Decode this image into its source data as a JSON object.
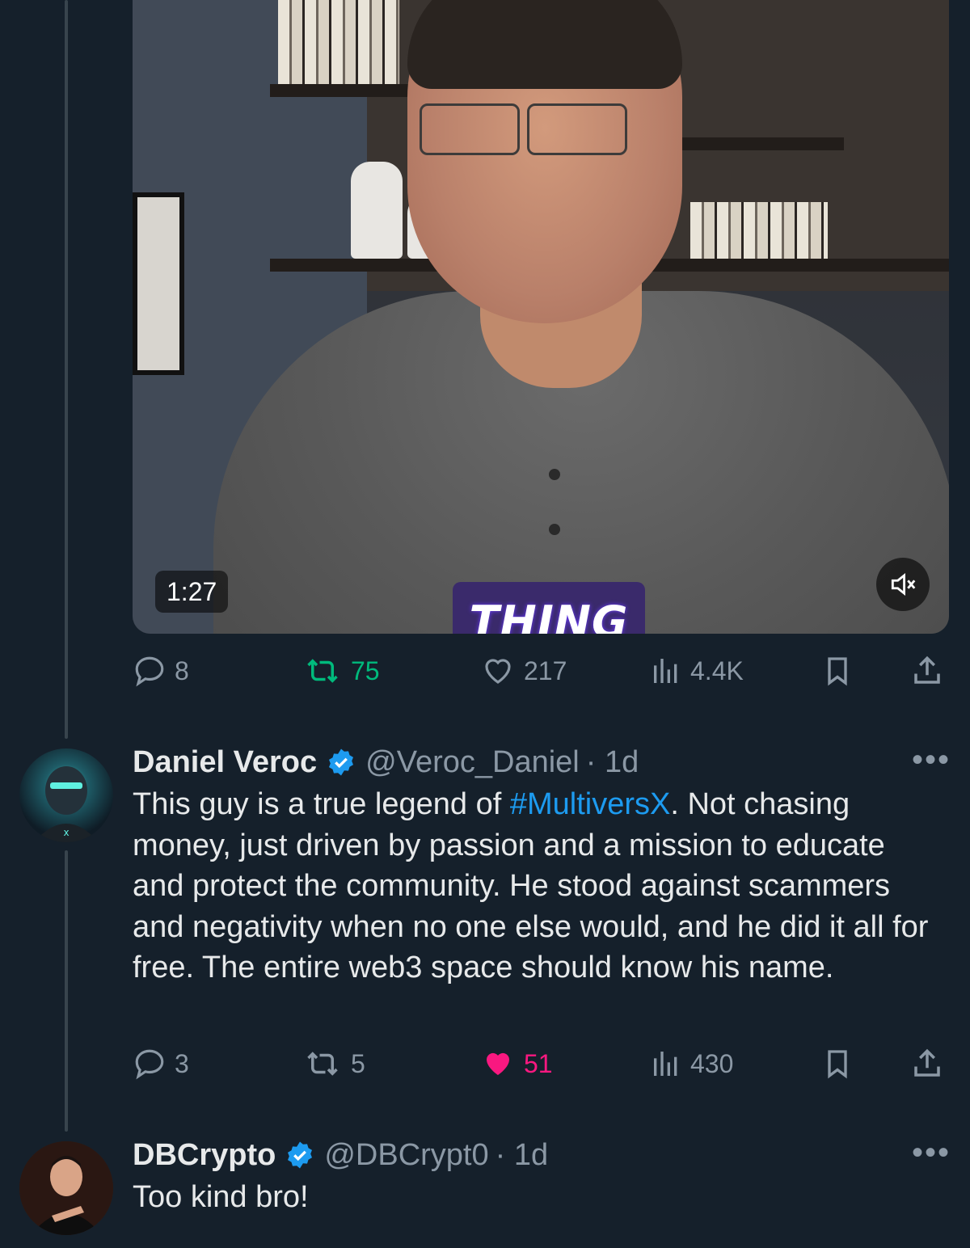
{
  "video": {
    "duration": "1:27",
    "caption": "THING",
    "muted_icon": "speaker-muted-icon"
  },
  "post1_actions": {
    "replies": "8",
    "reposts": "75",
    "likes": "217",
    "views": "4.4K"
  },
  "reply1": {
    "name": "Daniel Veroc",
    "handle": "@Veroc_Daniel",
    "time": "· 1d",
    "text_before": "This guy is a true legend of ",
    "hashtag": "#MultiversX",
    "text_after": ". Not chasing money, just driven by passion and a mission to educate and protect the community. He stood against scammers and negativity when no one else would, and he did it all for free. The entire web3 space should know his name.",
    "actions": {
      "replies": "3",
      "reposts": "5",
      "likes": "51",
      "views": "430",
      "liked": true
    }
  },
  "reply2": {
    "name": "DBCrypto",
    "handle": "@DBCrypt0",
    "time": "· 1d",
    "text": "Too kind bro!"
  },
  "colors": {
    "background": "#15202b",
    "accent": "#1d9bf0",
    "repost_green": "#00ba7c",
    "like_pink": "#f91880",
    "muted_text": "#8b98a5"
  },
  "icons": [
    "reply-icon",
    "repost-icon",
    "like-icon",
    "views-icon",
    "bookmark-icon",
    "share-icon",
    "verified-badge-icon",
    "more-icon"
  ]
}
